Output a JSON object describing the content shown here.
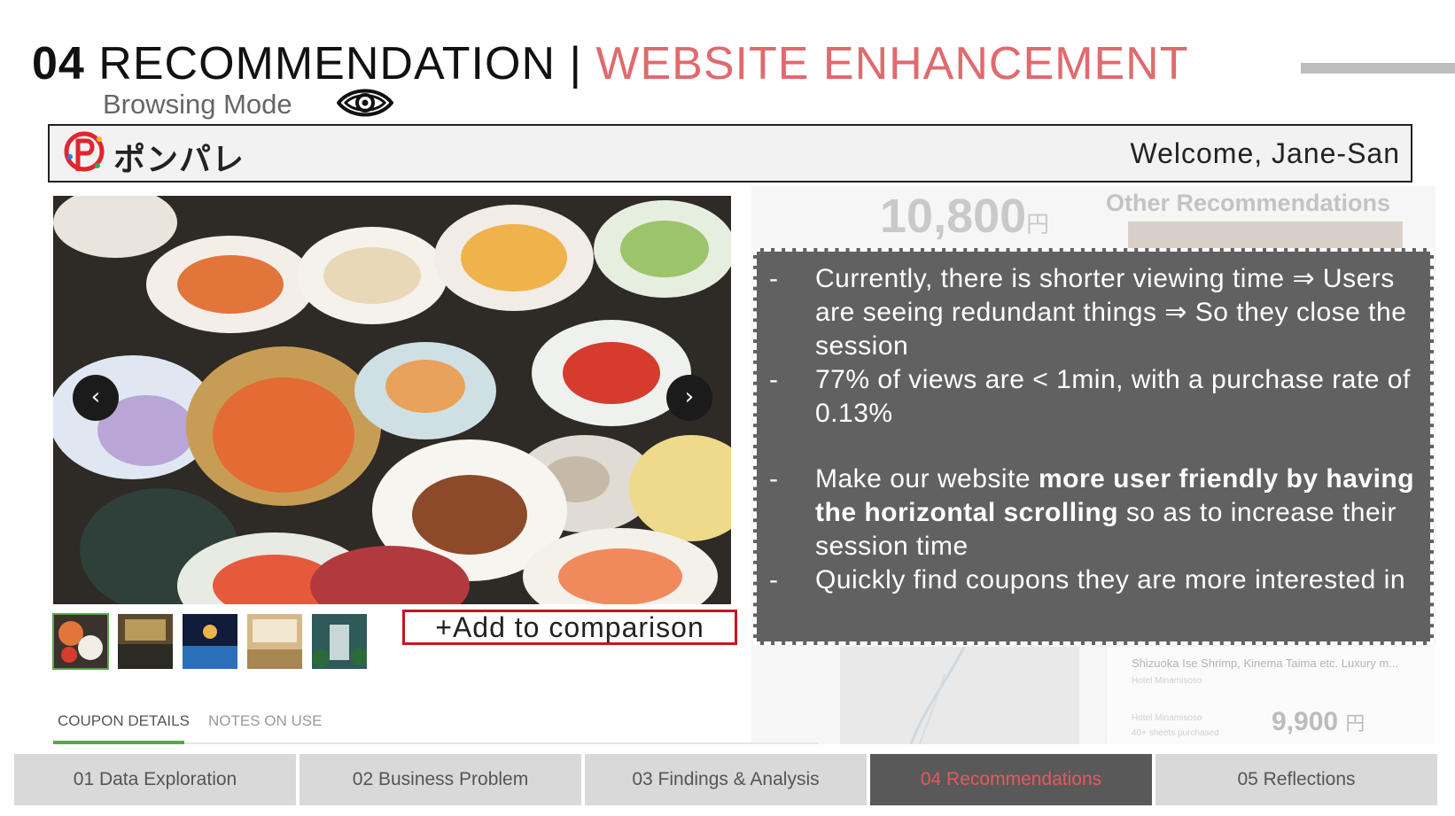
{
  "slide": {
    "number": "04",
    "title_main": "RECOMMENDATION",
    "title_separator": "|",
    "title_accent": "WEBSITE ENHANCEMENT",
    "subtitle": "Browsing Mode",
    "subtitle_icon": "eye-icon"
  },
  "app_header": {
    "logo_icon": "ponpare-p-logo-icon",
    "logo_text": "ポンパレ",
    "welcome": "Welcome, Jane-San"
  },
  "product": {
    "gallery_prev_icon": "chevron-left-icon",
    "gallery_next_icon": "chevron-right-icon",
    "prev_glyph": "‹",
    "next_glyph": "›",
    "thumbnails": [
      "food-spread",
      "hot-spring-bath",
      "night-pool",
      "japanese-room",
      "hotel-exterior"
    ],
    "compare_button": "+Add to comparison",
    "tabs": [
      "COUPON DETAILS",
      "NOTES ON USE"
    ]
  },
  "background_page": {
    "price": "10,800",
    "price_unit": "円",
    "other_recommendations": "Other Recommendations",
    "rec_title": "Shizuoka Ise Shrimp, Kinema Taima etc. Luxury m...",
    "rec_hotel": "Hotel Minamisoso",
    "rec_hotel_2": "Hotel Minamisoso",
    "rec_sold": "40+ sheets purchased",
    "rec_price": "9,900",
    "rec_price_unit": "円"
  },
  "callout": {
    "b1": "Currently, there is shorter viewing time ⇒ Users are seeing redundant things ⇒ So they close the session",
    "b2": "77% of views are < 1min, with a purchase rate of 0.13%",
    "b3_pre": "Make our website ",
    "b3_bold": "more user friendly by having the horizontal scrolling",
    "b3_post": " so as to increase their session time",
    "b4": "Quickly find coupons they are more interested in"
  },
  "bottom_nav": {
    "items": [
      "01 Data Exploration",
      "02 Business Problem",
      "03 Findings & Analysis",
      "04 Recommendations",
      "05 Reflections"
    ],
    "active_index": 3
  },
  "colors": {
    "accent_red": "#e06a6e",
    "callout_bg": "#616161",
    "active_nav_bg": "#595959",
    "active_nav_text": "#e8575d",
    "compare_border": "#c9151e",
    "tab_green": "#5aa64a"
  }
}
